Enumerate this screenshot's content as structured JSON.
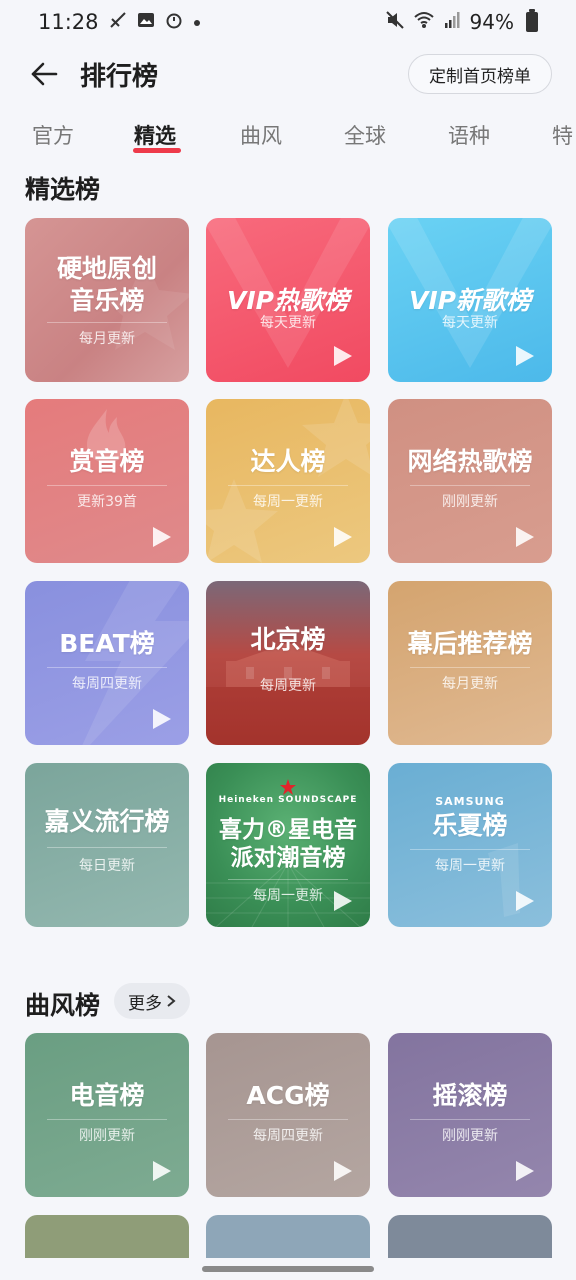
{
  "status_bar": {
    "time": "11:28",
    "battery": "94%",
    "icons": [
      "signal-off-icon",
      "image-icon",
      "timer-icon",
      "dot-icon",
      "mute-icon",
      "wifi-icon",
      "cell-signal-icon",
      "battery-icon"
    ]
  },
  "header": {
    "back_icon": "back-arrow-icon",
    "title": "排行榜",
    "customize_label": "定制首页榜单"
  },
  "tabs": {
    "items": [
      "官方",
      "精选",
      "曲风",
      "全球",
      "语种",
      "特"
    ],
    "active": "精选",
    "accent": "#ee3a4a"
  },
  "sections": {
    "featured": {
      "title": "精选榜"
    },
    "genre": {
      "title": "曲风榜",
      "more_label": "更多"
    }
  },
  "cards": [
    {
      "title_line1": "硬地原创",
      "title_line2": "音乐榜",
      "sub": "每月更新",
      "color": "#d48a8a"
    },
    {
      "title_line1": "VIP热歌榜",
      "sub": "每天更新",
      "color": "#f3566b"
    },
    {
      "title_line1": "VIP新歌榜",
      "sub": "每天更新",
      "color": "#5bc8ef"
    },
    {
      "title_line1": "赏音榜",
      "sub": "更新39首",
      "color": "#e07d7f"
    },
    {
      "title_line1": "达人榜",
      "sub": "每周一更新",
      "color": "#e9bf6e"
    },
    {
      "title_line1": "网络热歌榜",
      "sub": "刚刚更新",
      "color": "#d39382"
    },
    {
      "title_line1": "BEAT榜",
      "sub": "每周四更新",
      "color": "#8c92df"
    },
    {
      "title_line1": "北京榜",
      "sub": "每周更新",
      "color": "#b7453d"
    },
    {
      "title_line1": "幕后推荐榜",
      "sub": "每月更新",
      "color": "#d7a876"
    },
    {
      "title_line1": "嘉义流行榜",
      "sub": "每日更新",
      "color": "#86ada5"
    },
    {
      "title_line1": "喜力®星电音",
      "title_line2": "派对潮音榜",
      "logo": "Heineken SOUNDSCAPE",
      "sub": "每周一更新",
      "color": "#3f9a5d"
    },
    {
      "title_line1": "乐夏榜",
      "logo": "SAMSUNG",
      "sub": "每周一更新",
      "color": "#72b2d4"
    },
    {
      "title_line1": "电音榜",
      "sub": "刚刚更新",
      "color": "#6fa386"
    },
    {
      "title_line1": "ACG榜",
      "sub": "每周四更新",
      "color": "#a99a95"
    },
    {
      "title_line1": "摇滚榜",
      "sub": "刚刚更新",
      "color": "#8a7aa8"
    }
  ]
}
